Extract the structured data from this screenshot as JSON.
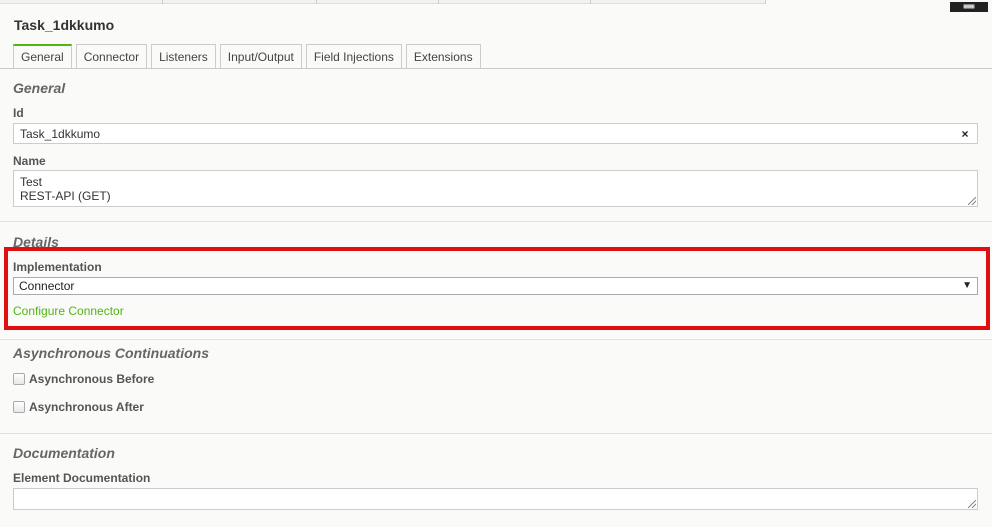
{
  "header": {
    "title": "Task_1dkkumo"
  },
  "tabs": [
    {
      "label": "General"
    },
    {
      "label": "Connector"
    },
    {
      "label": "Listeners"
    },
    {
      "label": "Input/Output"
    },
    {
      "label": "Field Injections"
    },
    {
      "label": "Extensions"
    }
  ],
  "general": {
    "title": "General",
    "id_label": "Id",
    "id_value": "Task_1dkkumo",
    "clear_symbol": "×",
    "name_label": "Name",
    "name_line1": "Test",
    "name_line2": "REST-API (GET)"
  },
  "details": {
    "title": "Details",
    "implementation_label": "Implementation",
    "implementation_value": "Connector",
    "configure_link": "Configure Connector"
  },
  "async": {
    "title": "Asynchronous Continuations",
    "before_label": "Asynchronous Before",
    "after_label": "Asynchronous After"
  },
  "documentation": {
    "title": "Documentation",
    "element_label": "Element Documentation"
  },
  "colors": {
    "accent": "#52b415",
    "highlight": "#e01010"
  }
}
